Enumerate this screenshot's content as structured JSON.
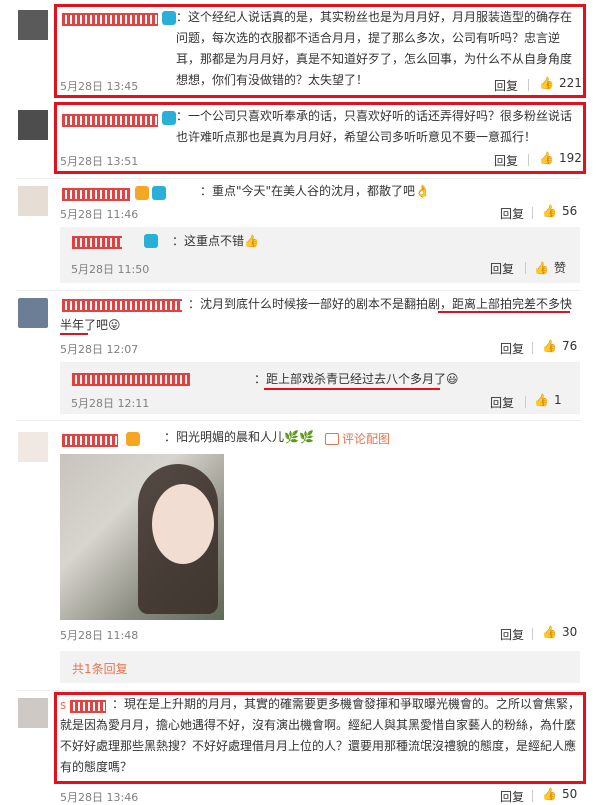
{
  "comments": [
    {
      "text": "：这个经纪人说话真的是，其实粉丝也是为月月好，月月服装造型的确存在问题，每次选的衣服都不适合月月，提了那么多次，公司有听吗？忠言逆耳，那都是为月月好，真是不知道好歹了，怎么回事，为什么不从自身角度想想，你们有没做错的？太失望了！",
      "time": "5月28日 13:45",
      "reply": "回复",
      "likes": "221"
    },
    {
      "text": "：一个公司只喜欢听奉承的话，只喜欢好听的话还弄得好吗？很多粉丝说话也许难听点那也是真为月月好，希望公司多听听意见不要一意孤行！",
      "time": "5月28日 13:51",
      "reply": "回复",
      "likes": "192"
    },
    {
      "text": "：重点\"今天\"在美人谷的沈月，都散了吧👌",
      "time": "5月28日 11:46",
      "reply": "回复",
      "likes": "56",
      "sub": {
        "text": "：这重点不错👍",
        "time": "5月28日 11:50",
        "reply": "回复",
        "likes": "赞"
      }
    },
    {
      "text": "：沈月到底什么时候接一部好的剧本不是翻拍剧，距离上部拍完差不多快半年了吧😛",
      "time": "5月28日 12:07",
      "reply": "回复",
      "likes": "76",
      "sub": {
        "text": "：距上部戏杀青已经过去八个多月了😃",
        "time": "5月28日 12:11",
        "reply": "回复",
        "likes": "1"
      }
    },
    {
      "text": "：阳光明媚的晨和人儿🌿🌿",
      "pic_link": "评论配图",
      "time": "5月28日 11:48",
      "reply": "回复",
      "likes": "30",
      "more": "共1条回复"
    },
    {
      "name": "s",
      "text": "：現在是上升期的月月，其實的確需要更多機會發揮和爭取曝光機會的。之所以會焦緊，就是因為愛月月，擔心她遇得不好，沒有演出機會啊。經紀人與其黑愛惜自家藝人的粉絲，為什麼不好好處理那些黑熱搜？不好好處理借月月上位的人？還要用那種流氓沒禮貌的態度，是經紀人應有的態度嗎？",
      "time": "5月28日 13:46",
      "reply": "回复",
      "likes": "50"
    }
  ],
  "colors": {
    "highlight": "#e4101c",
    "name": "#eb7350",
    "time": "#808080"
  }
}
